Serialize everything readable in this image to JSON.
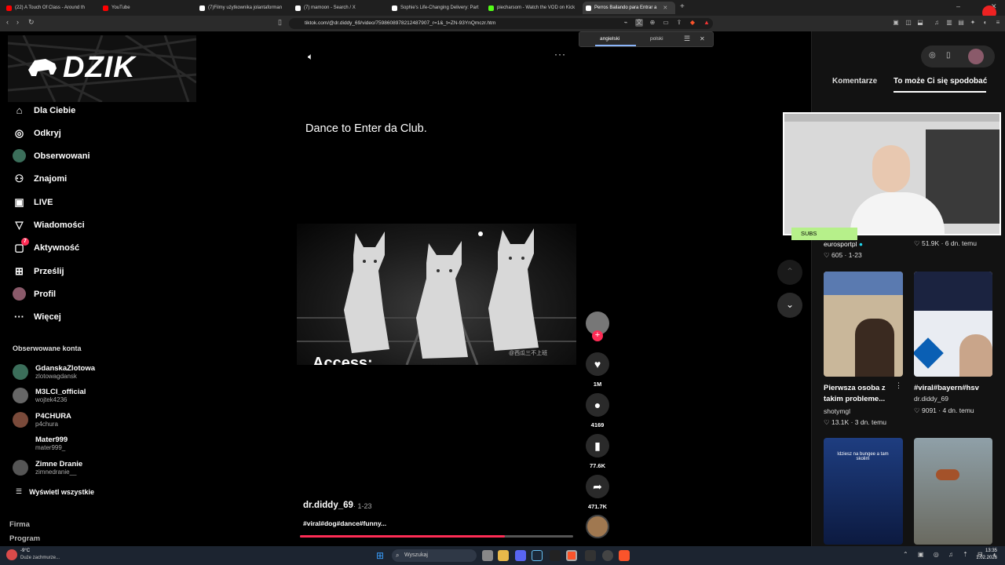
{
  "browser": {
    "tabs": [
      {
        "label": "(22) A Touch Of Class - Around th",
        "color": "#ff0000"
      },
      {
        "label": "YouTube",
        "color": "#ff0000"
      },
      {
        "label": "(7)Filmy użytkownika jolantaforman",
        "color": "#ffffff"
      },
      {
        "label": "(7) mamoon - Search / X",
        "color": "#ffffff"
      },
      {
        "label": "Sophie's Life-Changing Delivery: Part",
        "color": "#ffffff"
      },
      {
        "label": "piecharsom - Watch the VOD on Kick",
        "color": "#53fc18"
      },
      {
        "label": "Perros Bailando para Entrar a",
        "color": "#ffffff"
      }
    ],
    "url": "tiktok.com/@dr.diddy_69/video/7598608978212487907_r=1&_t=ZN-93YnQmczr.htm"
  },
  "translate_popup": {
    "lang1": "angielski",
    "lang2": "polski"
  },
  "sidebar": {
    "logo": "DZIK",
    "nav": [
      {
        "label": "Dla Ciebie",
        "icon": "home-icon"
      },
      {
        "label": "Odkryj",
        "icon": "compass-icon"
      },
      {
        "label": "Obserwowani",
        "icon": "following-icon"
      },
      {
        "label": "Znajomi",
        "icon": "friends-icon"
      },
      {
        "label": "LIVE",
        "icon": "live-icon"
      },
      {
        "label": "Wiadomości",
        "icon": "messages-icon"
      },
      {
        "label": "Aktywność",
        "icon": "activity-icon",
        "badge": "7"
      },
      {
        "label": "Prześlij",
        "icon": "upload-icon"
      },
      {
        "label": "Profil",
        "icon": "profile-icon"
      },
      {
        "label": "Więcej",
        "icon": "more-icon"
      }
    ],
    "following_header": "Obserwowane konta",
    "accounts": [
      {
        "name": "GdanskaZlotowa",
        "handle": "zlotowagdansk"
      },
      {
        "name": "M3LCI_official",
        "handle": "wojtek4236"
      },
      {
        "name": "P4CHURA",
        "handle": "p4chura"
      },
      {
        "name": "Mater999",
        "handle": "mater999_"
      },
      {
        "name": "Zimne Dranie",
        "handle": "zimnedranie__"
      }
    ],
    "show_all": "Wyświetl wszystkie",
    "footer": [
      "Firma",
      "Program"
    ]
  },
  "video": {
    "caption": "Dance to Enter da Club.",
    "overlay_text": "Access:",
    "watermark": "@西瓜三不上班",
    "author": "dr.diddy_69",
    "date": "· 1-23",
    "hashtags": "#viral#dog#dance#funny...",
    "progress": 0.75
  },
  "actions": {
    "likes": "1M",
    "comments": "4169",
    "saves": "77.6K",
    "shares": "471.7K"
  },
  "right_panel": {
    "tabs": [
      "Komentarze",
      "To może Ci się spodobać"
    ],
    "webcam_label": "SUBS",
    "items": [
      {
        "author": "eurosportpl",
        "likes": "605",
        "date": "· 1-23"
      },
      {
        "likes": "51.9K",
        "date": "· 6 dn. temu"
      },
      {
        "title": "Pierwsza osoba z takim probleme...",
        "author": "shotymgl",
        "likes": "13.1K",
        "date": "· 3 dn. temu"
      },
      {
        "title": "#viral#bayern#hsv",
        "author": "dr.diddy_69",
        "likes": "9091",
        "date": "· 4 dn. temu"
      }
    ],
    "tile_text": "Idziesz na bungee a tam skolim"
  },
  "taskbar": {
    "weather_temp": "-9°C",
    "weather_desc": "Duże zachmurze...",
    "search": "Wyszukaj",
    "time": "13:35",
    "date": "1.02.2026"
  }
}
